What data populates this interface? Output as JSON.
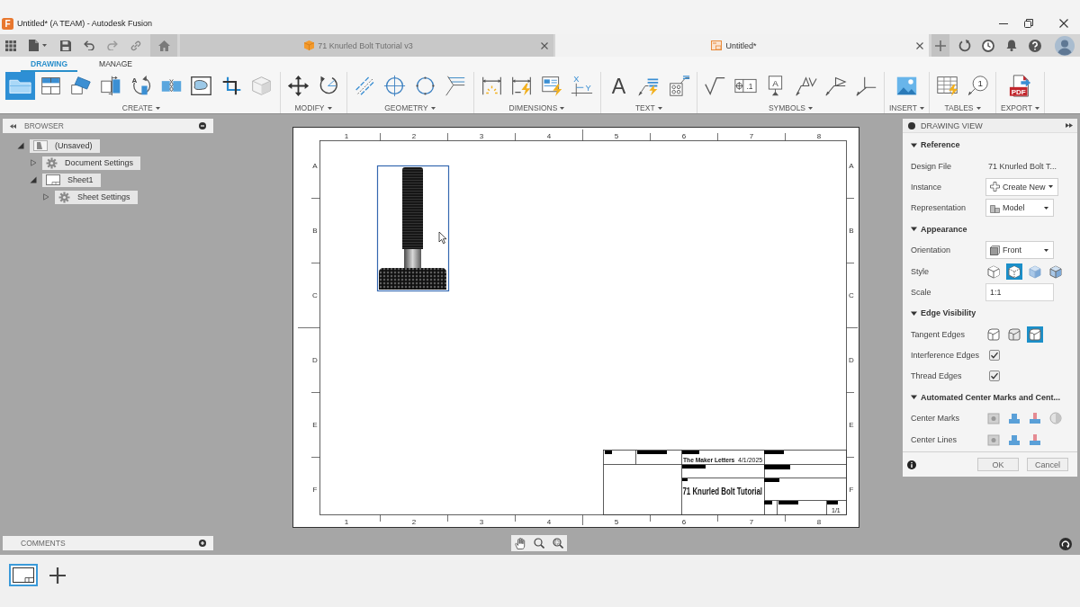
{
  "window": {
    "title": "Untitled* (A TEAM) - Autodesk Fusion",
    "logo_text": "F"
  },
  "document_tabs": [
    {
      "label": "71 Knurled Bolt Tutorial v3",
      "kind": "design",
      "selected": false
    },
    {
      "label": "Untitled*",
      "kind": "drawing",
      "selected": true
    }
  ],
  "ribbon": {
    "tabs": [
      {
        "label": "DRAWING",
        "selected": true
      },
      {
        "label": "MANAGE",
        "selected": false
      }
    ],
    "groups": [
      {
        "label": "CREATE",
        "tools": [
          {
            "selected": true
          },
          {
            "selected": false
          },
          {
            "selected": false
          },
          {
            "selected": false
          },
          {
            "selected": false,
            "glyphs": [
              "A"
            ]
          },
          {
            "selected": false
          },
          {
            "selected": false
          },
          {
            "selected": false
          },
          {
            "selected": false
          }
        ]
      },
      {
        "label": "MODIFY",
        "tools": [
          {
            "selected": false
          },
          {
            "selected": false
          }
        ]
      },
      {
        "label": "GEOMETRY",
        "tools": [
          {
            "selected": false
          },
          {
            "selected": false
          },
          {
            "selected": false
          },
          {
            "selected": false
          }
        ]
      },
      {
        "label": "DIMENSIONS",
        "tools": [
          {
            "selected": false
          },
          {
            "selected": false
          },
          {
            "selected": false
          },
          {
            "selected": false,
            "glyphs": [
              "X",
              "Y"
            ]
          }
        ]
      },
      {
        "label": "TEXT",
        "tools": [
          {
            "selected": false,
            "glyphs": [
              "A"
            ]
          },
          {
            "selected": false
          },
          {
            "selected": false
          }
        ]
      },
      {
        "label": "SYMBOLS",
        "tools": [
          {
            "selected": false
          },
          {
            "selected": false,
            "glyphs": [
              ".1"
            ]
          },
          {
            "selected": false,
            "glyphs": [
              "A"
            ]
          },
          {
            "selected": false
          },
          {
            "selected": false
          },
          {
            "selected": false
          }
        ]
      },
      {
        "label": "INSERT",
        "tools": [
          {
            "selected": false
          }
        ]
      },
      {
        "label": "TABLES",
        "tools": [
          {
            "selected": false
          },
          {
            "selected": false,
            "glyphs": [
              "1"
            ]
          }
        ]
      },
      {
        "label": "EXPORT",
        "tools": [
          {
            "selected": false,
            "glyphs": [
              "PDF"
            ]
          }
        ]
      }
    ]
  },
  "browser": {
    "title": "BROWSER",
    "tree": [
      {
        "label": "(Unsaved)",
        "kind": "document",
        "expanded": true,
        "children": [
          {
            "label": "Document Settings",
            "kind": "settings",
            "expanded": false
          },
          {
            "label": "Sheet1",
            "kind": "sheet",
            "expanded": true,
            "children": [
              {
                "label": "Sheet Settings",
                "kind": "settings",
                "expanded": false
              }
            ]
          }
        ]
      }
    ]
  },
  "sheet": {
    "top_labels": [
      "1",
      "2",
      "3",
      "4",
      "5",
      "6",
      "7",
      "8"
    ],
    "bottom_labels": [
      "1",
      "2",
      "3",
      "4",
      "5",
      "6",
      "7",
      "8"
    ],
    "left_labels": [
      "A",
      "B",
      "C",
      "D",
      "E",
      "F"
    ],
    "right_labels": [
      "A",
      "B",
      "C",
      "D",
      "E",
      "F"
    ],
    "drawing_view": {
      "selected": true
    },
    "title_block": {
      "company": "The Maker Letters",
      "date": "4/1/2025",
      "title": "71 Knurled Bolt Tutorial",
      "sheet_number": "1/1"
    }
  },
  "drawing_view_panel": {
    "title": "DRAWING VIEW",
    "sections": [
      {
        "title": "Reference",
        "expanded": true,
        "rows": [
          {
            "kind": "text",
            "label": "Design File",
            "value": "71 Knurled Bolt T..."
          },
          {
            "kind": "dropdown",
            "label": "Instance",
            "value": "Create New"
          },
          {
            "kind": "dropdown",
            "label": "Representation",
            "value": "Model"
          }
        ]
      },
      {
        "title": "Appearance",
        "expanded": true,
        "rows": [
          {
            "kind": "dropdown",
            "label": "Orientation",
            "value": "Front"
          },
          {
            "kind": "choice",
            "label": "Style",
            "options": [
              {
                "selected": false
              },
              {
                "selected": true
              },
              {
                "selected": false
              },
              {
                "selected": false
              }
            ]
          },
          {
            "kind": "input",
            "label": "Scale",
            "value": "1:1"
          }
        ]
      },
      {
        "title": "Edge Visibility",
        "expanded": true,
        "rows": [
          {
            "kind": "choice",
            "label": "Tangent Edges",
            "options": [
              {
                "selected": false
              },
              {
                "selected": false
              },
              {
                "selected": true
              }
            ]
          },
          {
            "kind": "checkbox",
            "label": "Interference Edges",
            "checked": true
          },
          {
            "kind": "checkbox",
            "label": "Thread Edges",
            "checked": true
          }
        ]
      },
      {
        "title": "Automated Center Marks and Cent...",
        "expanded": true,
        "rows": [
          {
            "kind": "choice",
            "label": "Center Marks",
            "options": [
              {
                "selected": false
              },
              {
                "selected": false
              },
              {
                "selected": false
              },
              {
                "selected": false
              }
            ]
          },
          {
            "kind": "choice",
            "label": "Center Lines",
            "options": [
              {
                "selected": false
              },
              {
                "selected": false
              },
              {
                "selected": false
              }
            ]
          }
        ]
      }
    ],
    "buttons": [
      {
        "label": "OK"
      },
      {
        "label": "Cancel"
      }
    ]
  },
  "comments": {
    "title": "COMMENTS"
  },
  "sheet_tabs": [
    {
      "selected": true
    }
  ]
}
